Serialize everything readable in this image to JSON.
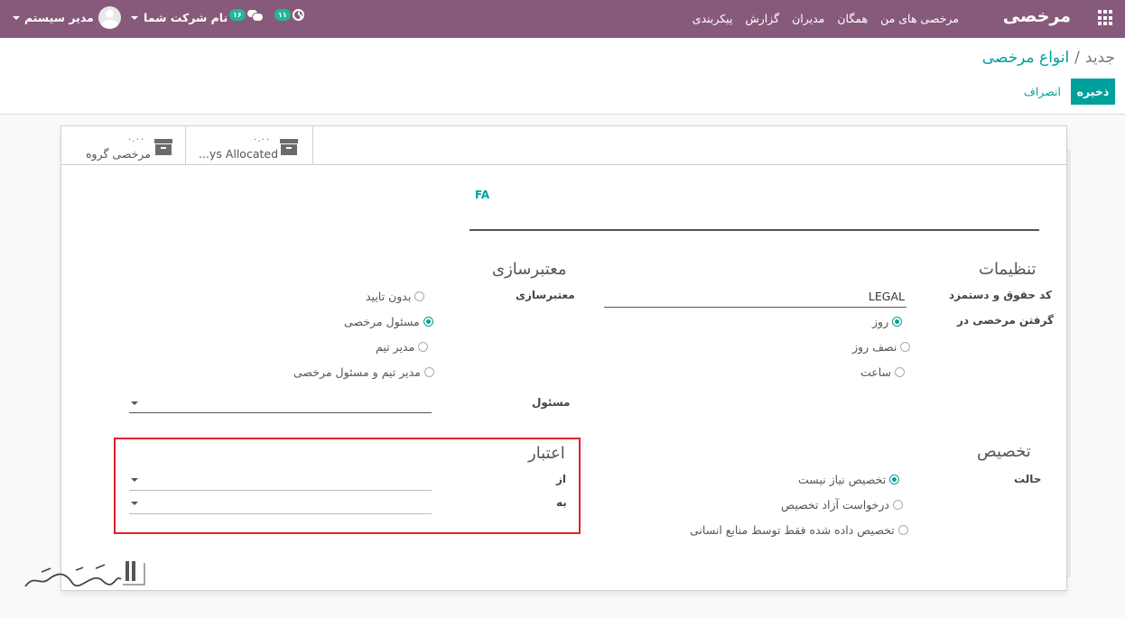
{
  "navbar": {
    "brand": "مرخصی",
    "menu": [
      "مرخصی های من",
      "همگان",
      "مدیران",
      "گزارش",
      "پیکربندی"
    ],
    "user_name": "مدیر سیستم",
    "company_name": "نام شرکت شما",
    "messages_count": "۱۶",
    "activities_count": "۱۱",
    "colors": {
      "bar": "#875a7b",
      "badge": "#21b799"
    },
    "icons": {
      "apps": "apps-grid-icon",
      "chat": "chat-icon",
      "activity": "clock-icon"
    }
  },
  "breadcrumb": {
    "parent": "انواع مرخصی",
    "separator": "/",
    "current": "جدید"
  },
  "buttons": {
    "save": "ذخیره",
    "discard": "انصراف"
  },
  "smart_buttons": [
    {
      "value": "۰.۰۰",
      "label": "مرخصی گروه",
      "icon": "archive-icon"
    },
    {
      "value": "۰.۰۰",
      "label": "...ys Allocated",
      "icon": "archive-icon"
    }
  ],
  "form": {
    "name_value": "FA",
    "settings": {
      "title": "تنظیمات",
      "payroll_code_label": "کد حقوق و دستمزد",
      "payroll_code_value": "LEGAL",
      "take_leave_label": "گرفتن مرخصی در",
      "take_leave_options": [
        {
          "label": "روز",
          "selected": true
        },
        {
          "label": "نصف روز",
          "selected": false
        },
        {
          "label": "ساعت",
          "selected": false
        }
      ]
    },
    "validation": {
      "title": "معتبرسازی",
      "field_label": "معتبرسازی",
      "options": [
        {
          "label": "بدون تایید",
          "selected": false
        },
        {
          "label": "مسئول مرخصی",
          "selected": true
        },
        {
          "label": "مدیر تیم",
          "selected": false
        },
        {
          "label": "مدیر تیم و مسئول مرخصی",
          "selected": false
        }
      ],
      "responsible_label": "مسئول"
    },
    "allocation": {
      "title": "تخصیص",
      "mode_label": "حالت",
      "options": [
        {
          "label": "تخصیص نیاز نیست",
          "selected": true
        },
        {
          "label": "درخواست آزاد تخصیص",
          "selected": false
        },
        {
          "label": "تخصیص داده شده فقط توسط منابع انسانی",
          "selected": false
        }
      ]
    },
    "validity": {
      "title": "اعتبار",
      "from_label": "از",
      "to_label": "به",
      "highlight_color": "#e0202b"
    }
  },
  "watermark_text": "تجربه‌گستر"
}
